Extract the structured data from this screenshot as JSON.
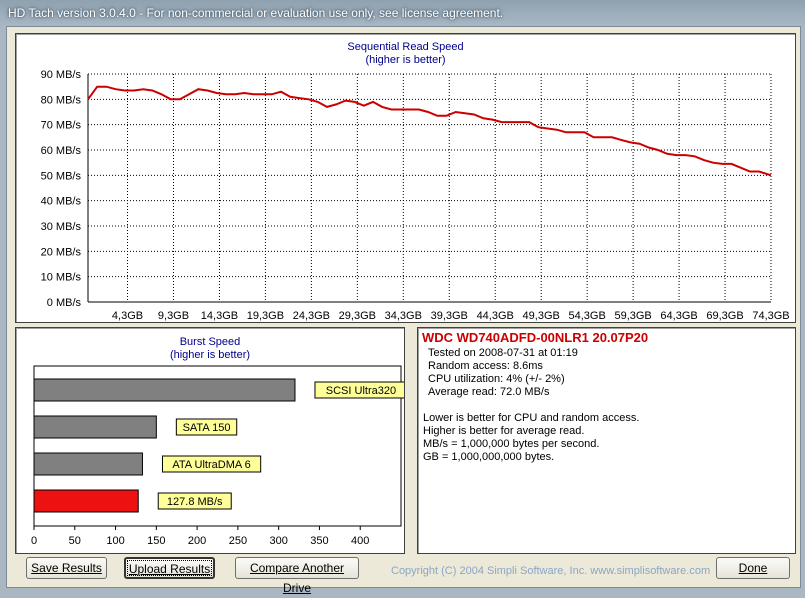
{
  "window": {
    "title": "HD Tach version 3.0.4.0  - For non-commercial or evaluation use only, see license agreement."
  },
  "sequential": {
    "title": "Sequential Read Speed",
    "subtitle": "(higher is better)"
  },
  "burst": {
    "title": "Burst Speed",
    "subtitle": "(higher is better)"
  },
  "info": {
    "drive": "WDC WD740ADFD-00NLR1 20.07P20",
    "tested_on": "Tested on 2008-07-31 at 01:19",
    "random_access": "Random access: 8.6ms",
    "cpu": "CPU utilization: 4% (+/- 2%)",
    "average_read": "Average read: 72.0 MB/s",
    "note1": "Lower is better for CPU and random access.",
    "note2": "Higher is better for average read.",
    "note3": "MB/s = 1,000,000 bytes per second.",
    "note4": "GB = 1,000,000,000 bytes."
  },
  "buttons": {
    "save": "Save Results",
    "upload": "Upload Results",
    "compare": "Compare Another Drive",
    "done": "Done"
  },
  "footer": {
    "copyright": "Copyright (C) 2004 Simpli Software, Inc. www.simplisoftware.com"
  },
  "colors": {
    "line": "#cc0000",
    "bar_gray": "#808080",
    "bar_red": "#ee1111",
    "label_bg": "#ffff99",
    "title_blue": "#00008b"
  },
  "chart_data": [
    {
      "type": "line",
      "title": "Sequential Read Speed",
      "subtitle": "(higher is better)",
      "ylabel": "",
      "xlabel": "",
      "ylim": [
        0,
        90
      ],
      "xlim": [
        0,
        74.3
      ],
      "yticks": [
        "0 MB/s",
        "10 MB/s",
        "20 MB/s",
        "30 MB/s",
        "40 MB/s",
        "50 MB/s",
        "60 MB/s",
        "70 MB/s",
        "80 MB/s",
        "90 MB/s"
      ],
      "xticks": [
        "4,3GB",
        "9,3GB",
        "14,3GB",
        "19,3GB",
        "24,3GB",
        "29,3GB",
        "34,3GB",
        "39,3GB",
        "44,3GB",
        "49,3GB",
        "54,3GB",
        "59,3GB",
        "64,3GB",
        "69,3GB",
        "74,3GB"
      ],
      "xtick_values": [
        4.3,
        9.3,
        14.3,
        19.3,
        24.3,
        29.3,
        34.3,
        39.3,
        44.3,
        49.3,
        54.3,
        59.3,
        64.3,
        69.3,
        74.3
      ],
      "grid": true,
      "series": [
        {
          "x": [
            0,
            1,
            2,
            3,
            4,
            5,
            6,
            7,
            8,
            9,
            10,
            11,
            12,
            13,
            14,
            15,
            16,
            17,
            18,
            19,
            20,
            21,
            22,
            23,
            24,
            25,
            26,
            27,
            28,
            29,
            30,
            31,
            32,
            33,
            34,
            35,
            36,
            37,
            38,
            39,
            40,
            41,
            42,
            43,
            44,
            45,
            46,
            47,
            48,
            49,
            50,
            51,
            52,
            53,
            54,
            55,
            56,
            57,
            58,
            59,
            60,
            61,
            62,
            63,
            64,
            65,
            66,
            67,
            68,
            69,
            70,
            71,
            72,
            73,
            74.3
          ],
          "y": [
            80,
            85,
            85,
            84,
            83.5,
            83.5,
            84,
            83.5,
            82,
            80,
            80,
            82,
            84,
            83.5,
            82.5,
            82,
            82,
            82.5,
            82,
            82,
            82,
            83,
            81,
            80.5,
            80,
            79,
            77,
            78,
            79.5,
            79,
            77.5,
            79,
            77,
            76,
            76,
            76,
            76,
            75,
            73.5,
            73.5,
            75,
            74.5,
            74,
            72.5,
            72,
            71,
            71,
            71,
            71,
            69,
            68.5,
            68,
            67,
            67,
            67,
            65,
            65,
            65,
            64,
            63,
            62.5,
            61,
            60,
            58.5,
            58,
            58,
            57.5,
            56,
            55,
            54.5,
            54.5,
            53,
            51.5,
            51.5,
            50
          ]
        }
      ]
    },
    {
      "type": "bar",
      "title": "Burst Speed",
      "subtitle": "(higher is better)",
      "orientation": "horizontal",
      "xlim": [
        0,
        450
      ],
      "xticks": [
        0,
        50,
        100,
        150,
        200,
        250,
        300,
        350,
        400
      ],
      "categories": [
        "SCSI Ultra320",
        "SATA 150",
        "ATA UltraDMA 6",
        "127.8 MB/s"
      ],
      "values": [
        320,
        150,
        133,
        127.8
      ],
      "bar_colors": [
        "#808080",
        "#808080",
        "#808080",
        "#ee1111"
      ]
    }
  ]
}
